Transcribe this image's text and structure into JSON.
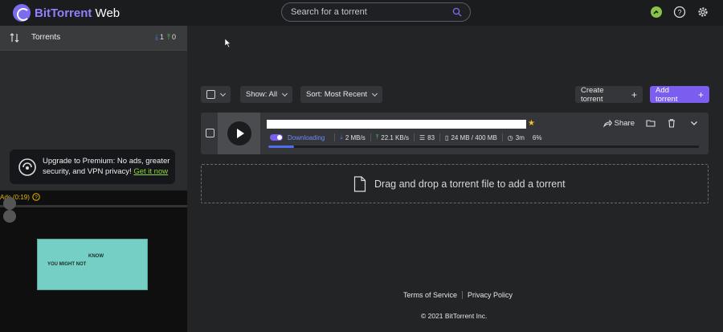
{
  "app": {
    "brand_first": "BitTorrent",
    "brand_second": " Web"
  },
  "search": {
    "placeholder": "Search for a torrent"
  },
  "sidebar": {
    "torrents_label": "Torrents",
    "download_count": "1",
    "upload_count": "0",
    "promo_text": "Upgrade to Premium: No ads, greater security, and VPN privacy!",
    "promo_link": "Get it now",
    "ad_label": "Ads (0:19)",
    "ad_line1": "KNOW",
    "ad_line2": "YOU MIGHT NOT"
  },
  "toolbar": {
    "show_label": "Show: All",
    "sort_label": "Sort: Most Recent",
    "create_label": "Create torrent",
    "add_label": "Add torrent"
  },
  "torrent": {
    "status": "Downloading",
    "download_speed": "2 MB/s",
    "upload_speed": "22.1 KB/s",
    "peers": "83",
    "size": "24 MB / 400 MB",
    "time_left": "3m",
    "percent": "6%",
    "progress": 0.06,
    "share_label": "Share"
  },
  "dropzone": {
    "text": "Drag and drop a torrent file to add a torrent"
  },
  "footer": {
    "terms": "Terms of Service",
    "privacy": "Privacy Policy",
    "copyright": "© 2021 BitTorrent Inc."
  },
  "colors": {
    "accent": "#7b5df0",
    "download": "#4a7fe0",
    "upload": "#5cb85c",
    "promo_link": "#8dd63a"
  }
}
